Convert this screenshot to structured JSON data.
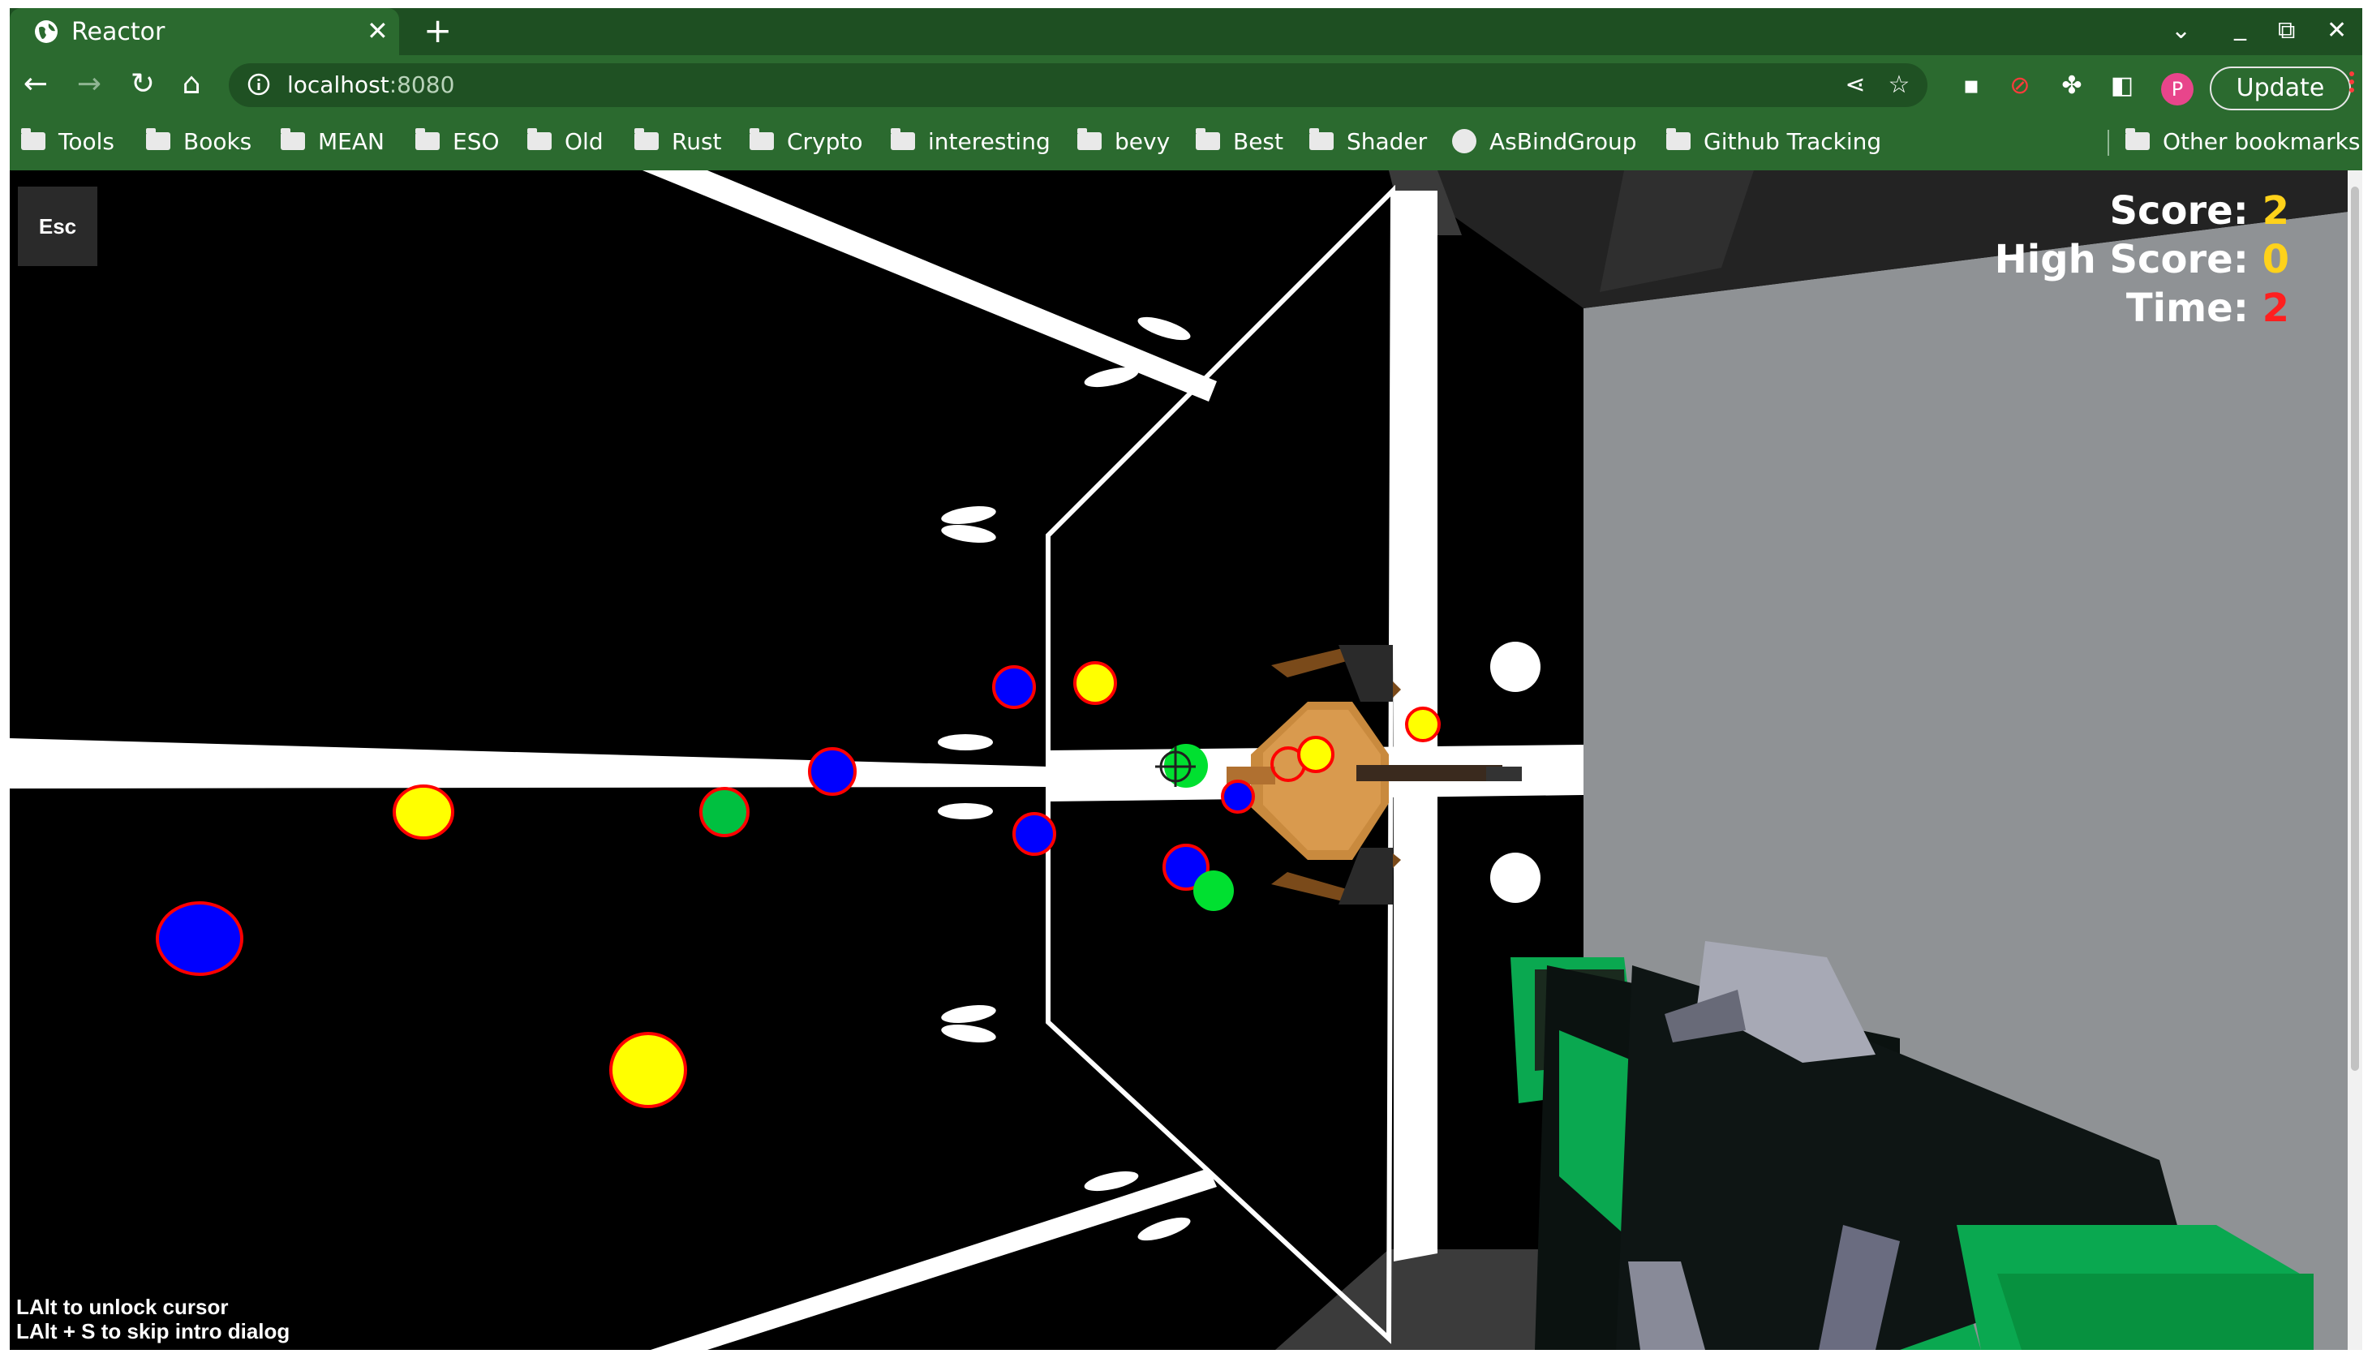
{
  "tab": {
    "title": "Reactor",
    "close_icon": "close-icon",
    "new_tab_icon": "plus-icon"
  },
  "window_controls": [
    "chevron-down-icon",
    "minimize-icon",
    "restore-icon",
    "close-icon"
  ],
  "omnibox": {
    "url_host": "localhost",
    "url_port": ":8080"
  },
  "toolbar": {
    "update_label": "Update",
    "avatar_initial": "P"
  },
  "bookmarks": [
    {
      "label": "Tools",
      "icon": "folder-icon"
    },
    {
      "label": "Books",
      "icon": "folder-icon"
    },
    {
      "label": "MEAN",
      "icon": "folder-icon"
    },
    {
      "label": "ESO",
      "icon": "folder-icon"
    },
    {
      "label": "Old",
      "icon": "folder-icon"
    },
    {
      "label": "Rust",
      "icon": "folder-icon"
    },
    {
      "label": "Crypto",
      "icon": "folder-icon"
    },
    {
      "label": "interesting",
      "icon": "folder-icon"
    },
    {
      "label": "bevy",
      "icon": "folder-icon"
    },
    {
      "label": "Best",
      "icon": "folder-icon"
    },
    {
      "label": "Shader",
      "icon": "folder-icon"
    },
    {
      "label": "AsBindGroup",
      "icon": "globe-icon"
    },
    {
      "label": "Github Tracking",
      "icon": "folder-icon"
    }
  ],
  "other_bookmarks": "Other bookmarks",
  "game": {
    "esc_label": "Esc",
    "hud": {
      "score_label": "Score: ",
      "score_value": "2",
      "high_score_label": "High Score: ",
      "high_score_value": "0",
      "time_label": "Time: ",
      "time_value": "2"
    },
    "hints": [
      "LAlt to unlock cursor",
      "LAlt + S to skip intro dialog"
    ],
    "colors": {
      "score": "#ffd21a",
      "time": "#ff1f1f",
      "orb_yellow": "#ffff00",
      "orb_blue": "#0000ff",
      "orb_green": "#00c040",
      "orb_outline": "#ff0000",
      "wall": "#8f9295",
      "gun_green": "#0aa850"
    }
  }
}
